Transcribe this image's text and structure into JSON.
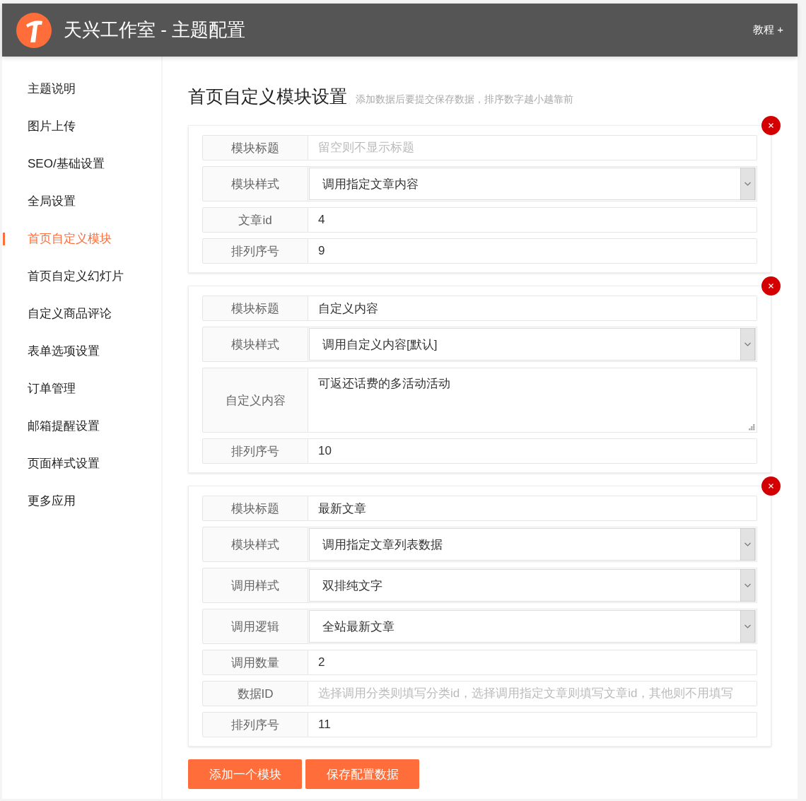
{
  "header": {
    "title": "天兴工作室 - 主题配置",
    "menu": "教程 +"
  },
  "sidebar": {
    "items": [
      {
        "label": "主题说明",
        "selected": false
      },
      {
        "label": "图片上传",
        "selected": false
      },
      {
        "label": "SEO/基础设置",
        "selected": false
      },
      {
        "label": "全局设置",
        "selected": false
      },
      {
        "label": "首页自定义模块",
        "selected": true
      },
      {
        "label": "首页自定义幻灯片",
        "selected": false
      },
      {
        "label": "自定义商品评论",
        "selected": false
      },
      {
        "label": "表单选项设置",
        "selected": false
      },
      {
        "label": "订单管理",
        "selected": false
      },
      {
        "label": "邮箱提醒设置",
        "selected": false
      },
      {
        "label": "页面样式设置",
        "selected": false
      },
      {
        "label": "更多应用",
        "selected": false
      }
    ]
  },
  "section": {
    "title": "首页自定义模块设置",
    "hint": "添加数据后要提交保存数据，排序数字越小越靠前"
  },
  "modules": [
    {
      "fields": [
        {
          "kind": "text",
          "label": "模块标题",
          "placeholder": "留空则不显示标题"
        },
        {
          "kind": "select",
          "label": "模块样式",
          "value": "调用指定文章内容"
        },
        {
          "kind": "text",
          "label": "文章id",
          "value": "4"
        },
        {
          "kind": "text",
          "label": "排列序号",
          "value": "9"
        }
      ]
    },
    {
      "fields": [
        {
          "kind": "text",
          "label": "模块标题",
          "value": "自定义内容"
        },
        {
          "kind": "select",
          "label": "模块样式",
          "value": "调用自定义内容[默认]"
        },
        {
          "kind": "textarea",
          "label": "自定义内容",
          "value": "可返还话费的多活动活动"
        },
        {
          "kind": "text",
          "label": "排列序号",
          "value": "10"
        }
      ]
    },
    {
      "fields": [
        {
          "kind": "text",
          "label": "模块标题",
          "value": "最新文章"
        },
        {
          "kind": "select",
          "label": "模块样式",
          "value": "调用指定文章列表数据"
        },
        {
          "kind": "select",
          "label": "调用样式",
          "value": "双排纯文字"
        },
        {
          "kind": "select",
          "label": "调用逻辑",
          "value": "全站最新文章"
        },
        {
          "kind": "text",
          "label": "调用数量",
          "value": "2"
        },
        {
          "kind": "text",
          "label": "数据ID",
          "placeholder": "选择调用分类则填写分类id，选择调用指定文章则填写文章id，其他则不用填写"
        },
        {
          "kind": "text",
          "label": "排列序号",
          "value": "11"
        }
      ]
    }
  ],
  "buttons": [
    "添加一个模块",
    "保存配置数据"
  ]
}
